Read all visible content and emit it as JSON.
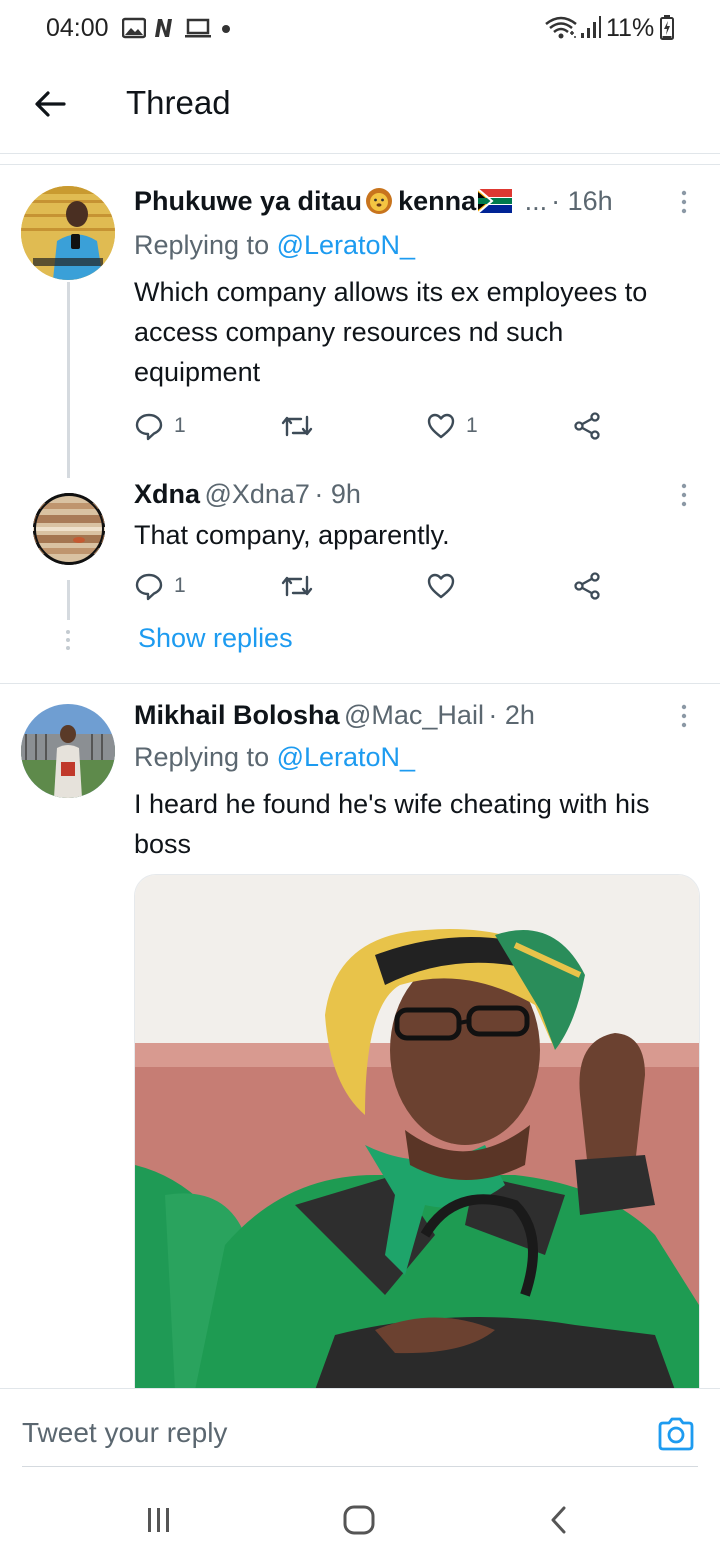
{
  "status_bar": {
    "time": "04:00",
    "battery": "11%",
    "icons": [
      "image-icon",
      "netflix-n-icon",
      "laptop-icon",
      "dot-icon",
      "wifi-icon",
      "signal-icon",
      "battery-charging-icon"
    ]
  },
  "header": {
    "title": "Thread",
    "back_icon": "back-arrow-icon"
  },
  "tweets": [
    {
      "display_name": "Phukuwe ya ditau",
      "name_suffix": "kenna",
      "emojis": [
        "lion-face-emoji",
        "south-africa-flag-emoji"
      ],
      "ellipsis": "...",
      "time": "· 16h",
      "replying_prefix": "Replying to ",
      "replying_to": "@LeratoN_",
      "text": "Which company allows its ex employees to access company resources nd such equipment",
      "reply_count": "1",
      "retweet_count": "",
      "like_count": "1"
    },
    {
      "display_name": "Xdna",
      "handle": "@Xdna7",
      "time": "· 9h",
      "text": "That company, apparently.",
      "reply_count": "1",
      "retweet_count": "",
      "like_count": ""
    },
    {
      "display_name": "Mikhail Bolosha",
      "handle": "@Mac_Hail",
      "time": "· 2h",
      "replying_prefix": "Replying to ",
      "replying_to": "@LeratoN_",
      "text": "I heard he found he's wife cheating with his boss"
    }
  ],
  "show_replies": "Show replies",
  "reply_bar": {
    "placeholder": "Tweet your reply",
    "camera_icon": "camera-icon"
  },
  "nav_bar": {
    "icons": [
      "recents-icon",
      "home-icon",
      "back-icon"
    ]
  },
  "colors": {
    "accent": "#1d9bf0",
    "text": "#0f1419",
    "muted": "#5b6770",
    "divider": "#e1e6ea"
  }
}
